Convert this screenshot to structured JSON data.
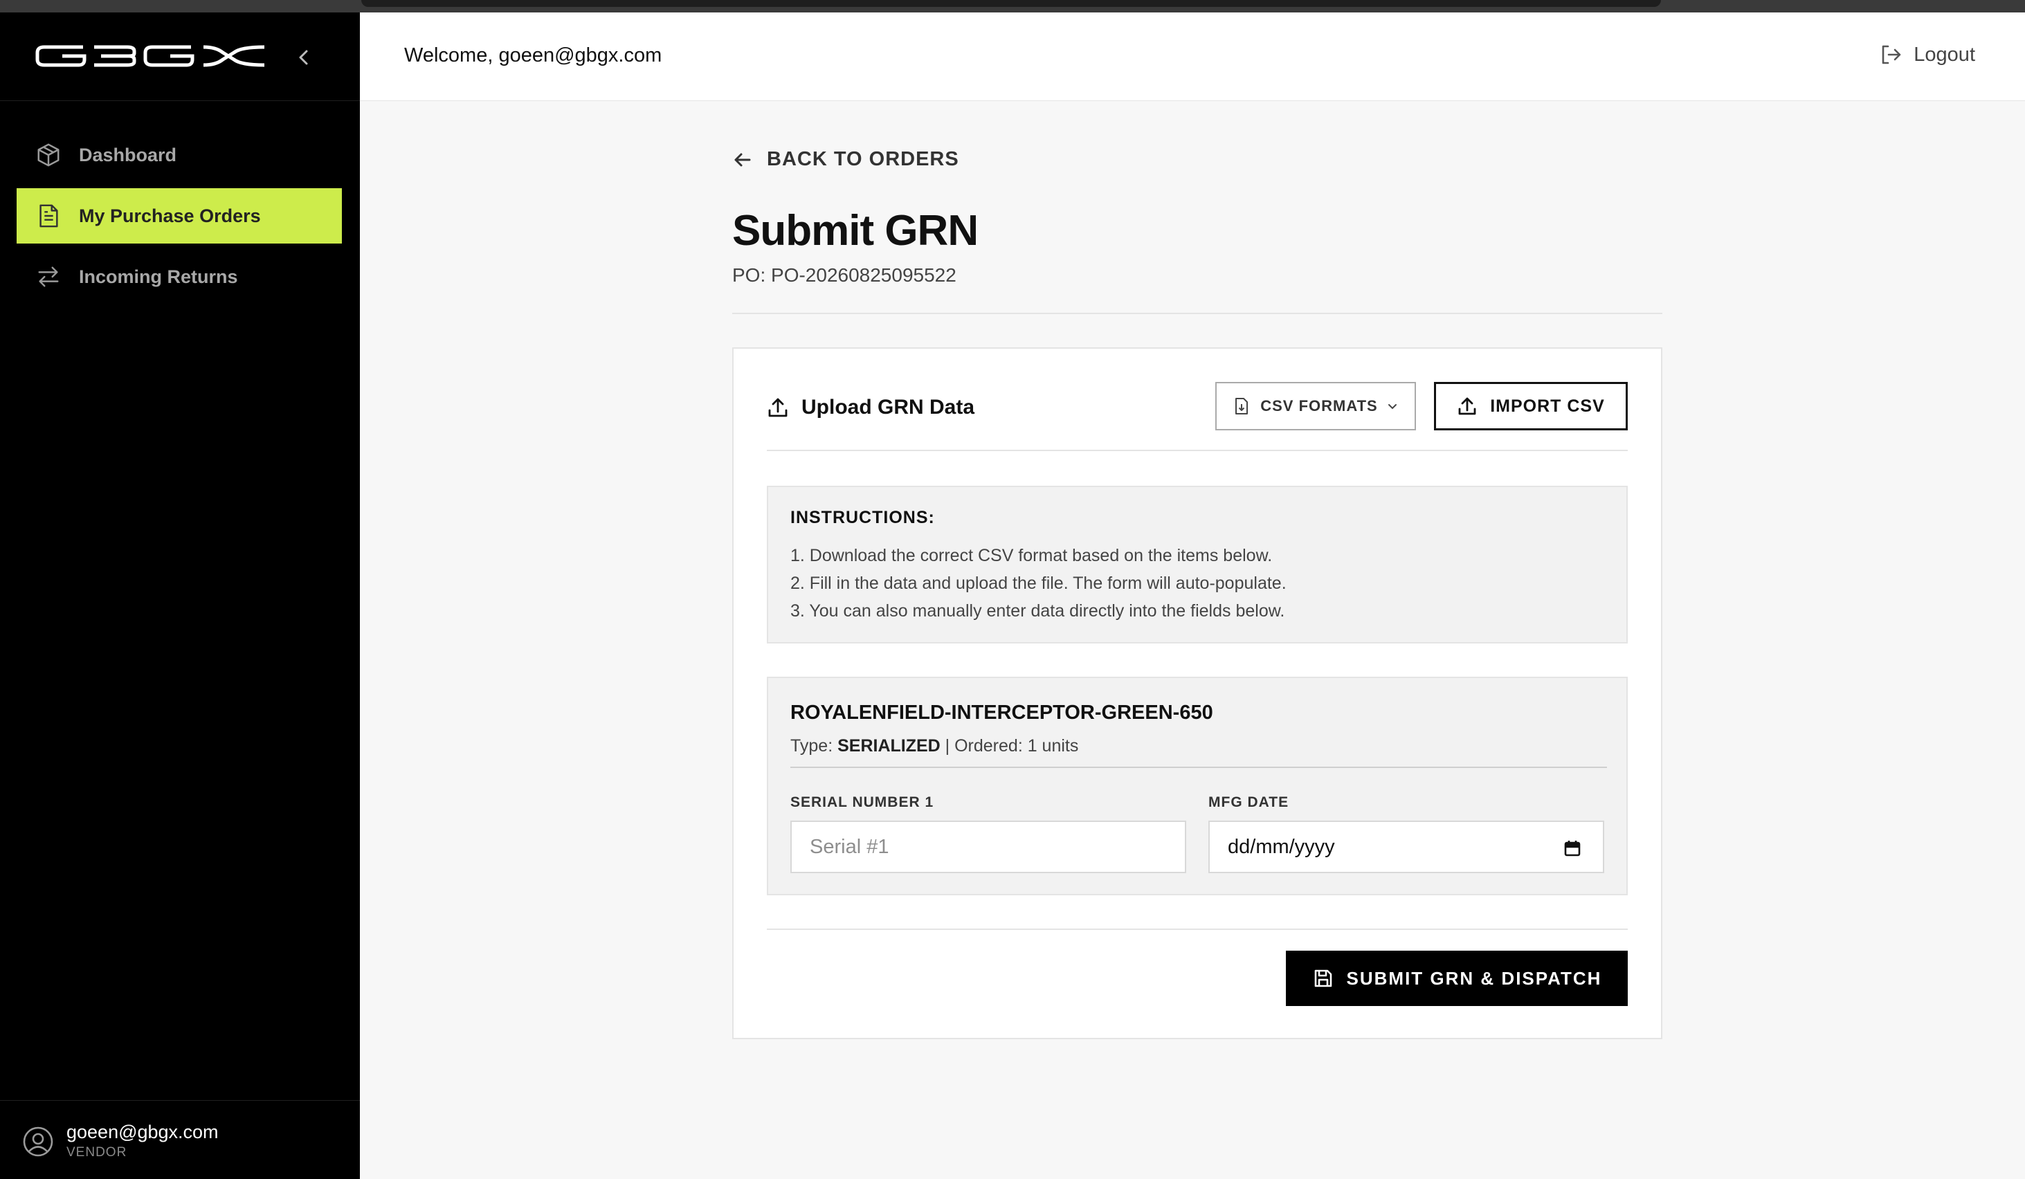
{
  "brand": {
    "logo_text": "GBGX",
    "accent_color": "#cdec4b"
  },
  "sidebar": {
    "items": [
      {
        "label": "Dashboard",
        "icon": "package-icon",
        "active": false
      },
      {
        "label": "My Purchase Orders",
        "icon": "document-icon",
        "active": true
      },
      {
        "label": "Incoming Returns",
        "icon": "swap-arrows-icon",
        "active": false
      }
    ],
    "user": {
      "email": "goeen@gbgx.com",
      "role": "VENDOR"
    }
  },
  "header": {
    "welcome": "Welcome, goeen@gbgx.com",
    "logout_label": "Logout"
  },
  "page": {
    "back_label": "BACK TO ORDERS",
    "title": "Submit GRN",
    "po_number": "PO: PO-20260825095522"
  },
  "upload": {
    "title": "Upload GRN Data",
    "csv_formats_label": "CSV FORMATS",
    "import_label": "IMPORT CSV"
  },
  "instructions": {
    "heading": "INSTRUCTIONS:",
    "lines": [
      "1. Download the correct CSV format based on the items below.",
      "2. Fill in the data and upload the file. The form will auto-populate.",
      "3. You can also manually enter data directly into the fields below."
    ]
  },
  "item": {
    "sku": "ROYALENFIELD-INTERCEPTOR-GREEN-650",
    "type_prefix": "Type: ",
    "type": "SERIALIZED",
    "ordered_text": " | Ordered: 1 units",
    "serial_label": "SERIAL NUMBER 1",
    "serial_placeholder": "Serial #1",
    "mfg_label": "MFG DATE",
    "mfg_value": "dd/mm/yyyy"
  },
  "submit_label": "SUBMIT GRN & DISPATCH"
}
